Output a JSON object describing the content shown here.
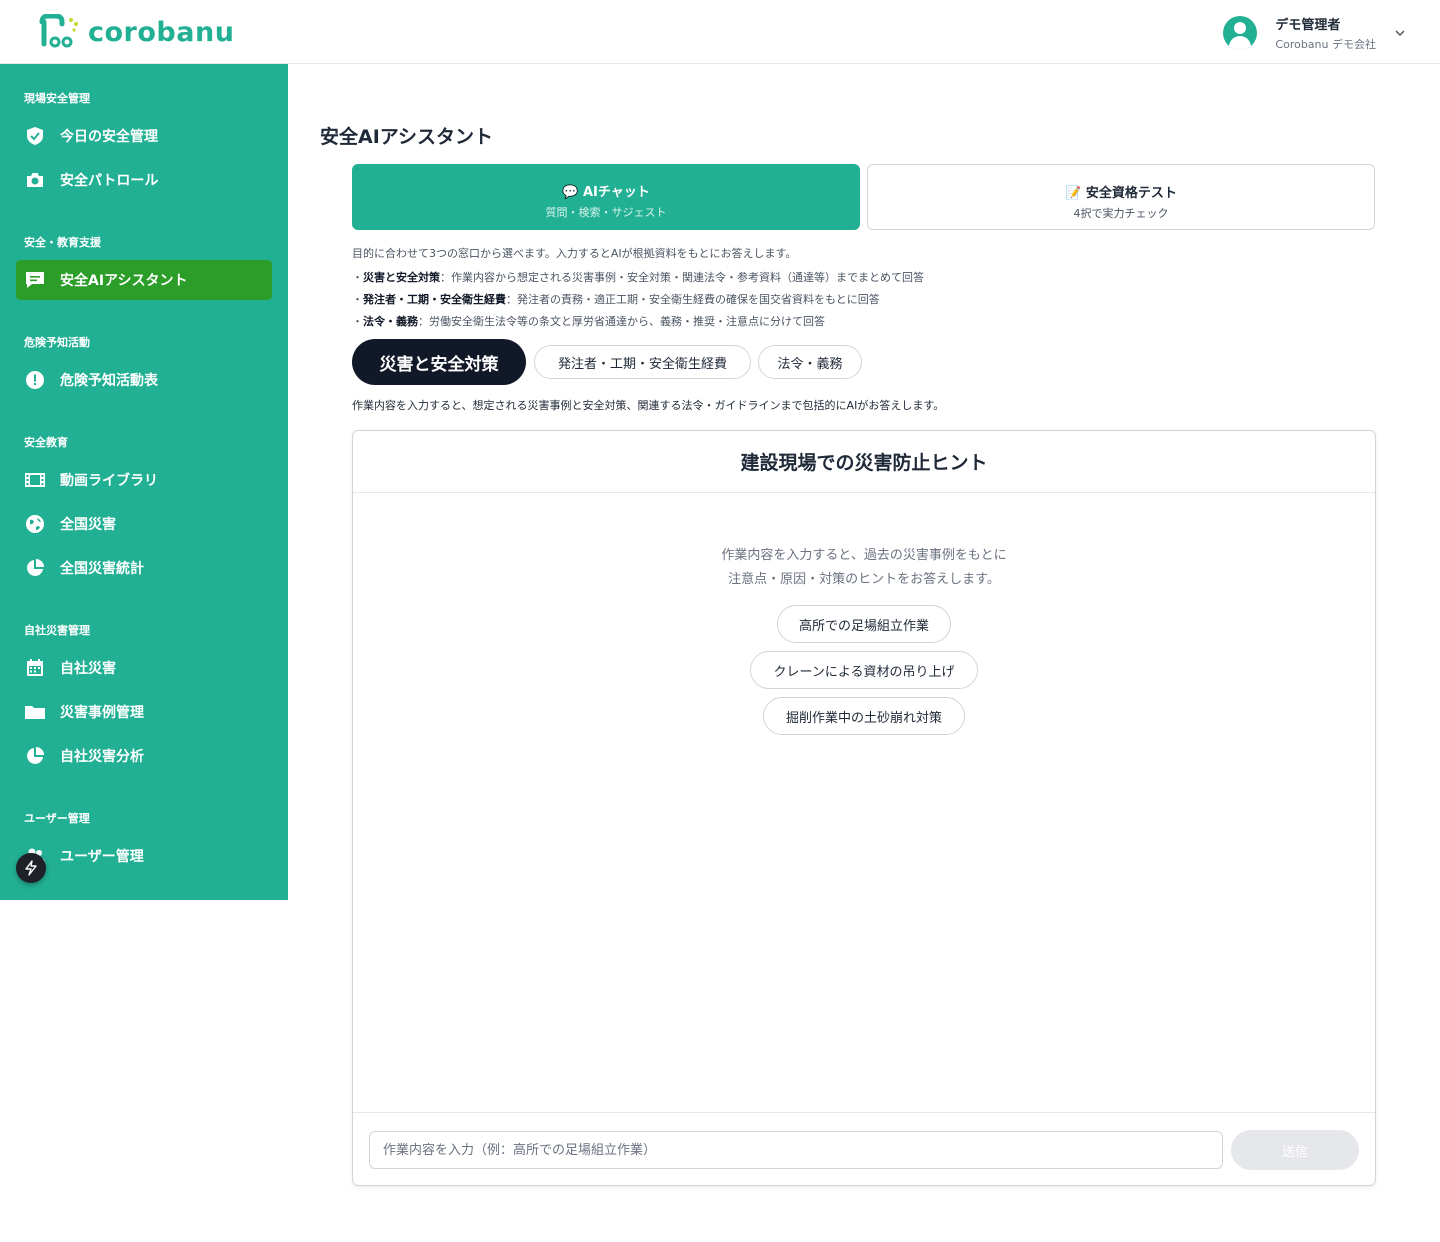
{
  "header": {
    "logo_text": "corobanu",
    "user_name": "デモ管理者",
    "user_company": "Corobanu デモ会社"
  },
  "sidebar": {
    "sections": [
      {
        "label": "現場安全管理",
        "items": [
          {
            "label": "今日の安全管理",
            "icon": "shield-check-icon"
          },
          {
            "label": "安全パトロール",
            "icon": "camera-icon"
          }
        ]
      },
      {
        "label": "安全・教育支援",
        "items": [
          {
            "label": "安全AIアシスタント",
            "icon": "chat-icon",
            "active": true
          }
        ]
      },
      {
        "label": "危険予知活動",
        "items": [
          {
            "label": "危険予知活動表",
            "icon": "alert-icon"
          }
        ]
      },
      {
        "label": "安全教育",
        "items": [
          {
            "label": "動画ライブラリ",
            "icon": "film-icon"
          },
          {
            "label": "全国災害",
            "icon": "globe-icon"
          },
          {
            "label": "全国災害統計",
            "icon": "pie-chart-icon"
          }
        ]
      },
      {
        "label": "自社災害管理",
        "items": [
          {
            "label": "自社災害",
            "icon": "calendar-icon"
          },
          {
            "label": "災害事例管理",
            "icon": "folder-icon"
          },
          {
            "label": "自社災害分析",
            "icon": "pie-chart-icon"
          }
        ]
      },
      {
        "label": "ユーザー管理",
        "items": [
          {
            "label": "ユーザー管理",
            "icon": "users-icon"
          }
        ]
      }
    ],
    "accent": "#22b094",
    "active_color": "#2d9d2a"
  },
  "main": {
    "title": "安全AIアシスタント",
    "modes": [
      {
        "title": "💬 AIチャット",
        "subtitle": "質問・検索・サジェスト",
        "active": true
      },
      {
        "title": "📝 安全資格テスト",
        "subtitle": "4択で実力チェック",
        "active": false
      }
    ],
    "intro": "目的に合わせて3つの窓口から選べます。入力するとAIが根拠資料をもとにお答えします。",
    "bullets": [
      {
        "prefix": "・",
        "term": "災害と安全対策",
        "desc": "：作業内容から想定される災害事例・安全対策・関連法令・参考資料（通達等）までまとめて回答"
      },
      {
        "prefix": "・",
        "term": "発注者・工期・安全衛生経費",
        "desc": "：発注者の責務・適正工期・安全衛生経費の確保を国交省資料をもとに回答"
      },
      {
        "prefix": "・",
        "term": "法令・義務",
        "desc": "：労働安全衛生法令等の条文と厚労省通達から、義務・推奨・注意点に分けて回答"
      }
    ],
    "chips": [
      "災害と安全対策",
      "発注者・工期・安全衛生経費",
      "法令・義務"
    ],
    "chip_description": "作業内容を入力すると、想定される災害事例と安全対策、関連する法令・ガイドラインまで包括的にAIがお答えします。",
    "panel": {
      "title": "建設現場での災害防止ヒント",
      "hint_lines": [
        "作業内容を入力すると、過去の災害事例をもとに",
        "注意点・原因・対策のヒントをお答えします。"
      ],
      "suggestions": [
        "高所での足場組立作業",
        "クレーンによる資材の吊り上げ",
        "掘削作業中の土砂崩れ対策"
      ],
      "input_placeholder": "作業内容を入力（例：高所での足場組立作業）",
      "send_label": "送信"
    }
  }
}
